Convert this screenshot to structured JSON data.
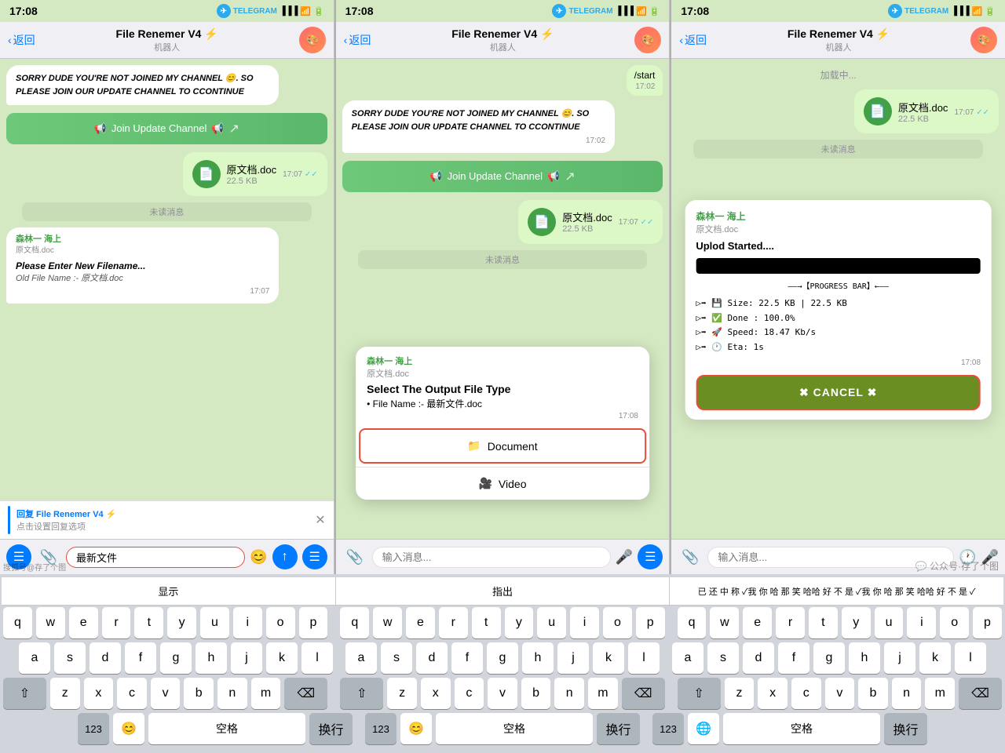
{
  "screens": [
    {
      "id": "screen1",
      "statusBar": {
        "time": "17:08",
        "telegramLabel": "TELEGRAM"
      },
      "navBar": {
        "backLabel": "返回",
        "titleMain": "File Renemer V4 ⚡",
        "titleSub": "机器人"
      },
      "messages": [
        {
          "type": "received",
          "text": "Sorry Dude You're Not Joined My Channel 😊. So Please Join Our Update Channel To Ccontinue",
          "time": ""
        },
        {
          "type": "join-button",
          "label": "📢 Join Update Channel 📢"
        },
        {
          "type": "sent-file",
          "name": "原文档.doc",
          "size": "22.5 KB",
          "time": "17:07"
        }
      ],
      "unreadDivider": "未读消息",
      "receivedMessages2": [
        {
          "type": "received-card",
          "sender": "森林一 海上",
          "filename": "原文档.doc",
          "text": "Please Enter New Filename...",
          "subtext": "Old File Name :- 原文档.doc",
          "time": "17:07"
        }
      ],
      "replyBar": {
        "botName": "回复 File Renemer V4 ⚡",
        "hint": "点击设置回复选项"
      },
      "inputBar": {
        "value": "最新文件",
        "placeholder": "输入消息..."
      }
    },
    {
      "id": "screen2",
      "statusBar": {
        "time": "17:08",
        "telegramLabel": "TELEGRAM"
      },
      "navBar": {
        "backLabel": "返回",
        "titleMain": "File Renemer V4 ⚡",
        "titleSub": "机器人"
      },
      "messages": [
        {
          "type": "sent-partial",
          "text": "/start",
          "time": "17:02"
        },
        {
          "type": "received",
          "text": "Sorry Dude You're Not Joined My Channel 😊. So Please Join Our Update Channel To Ccontinue",
          "time": "17:02"
        },
        {
          "type": "join-button",
          "label": "📢 Join Update Channel 📢"
        },
        {
          "type": "sent-file",
          "name": "原文档.doc",
          "size": "22.5 KB",
          "time": "17:07"
        }
      ],
      "unreadDivider": "未读消息",
      "popup": {
        "sender": "森林一 海上",
        "filename": "原文档.doc",
        "title": "Select The Output File Type",
        "subtitle": "• File Name :- 最新文件.doc",
        "time": "17:08",
        "btnDoc": "📁 Document",
        "btnVideo": "🎥 Video"
      },
      "inputBar": {
        "value": "",
        "placeholder": "输入消息..."
      }
    },
    {
      "id": "screen3",
      "statusBar": {
        "time": "17:08",
        "telegramLabel": "TELEGRAM"
      },
      "navBar": {
        "backLabel": "返回",
        "titleMain": "File Renemer V4 ⚡",
        "titleSub": "机器人"
      },
      "messages": [
        {
          "type": "loading",
          "text": "加载中..."
        },
        {
          "type": "sent-file",
          "name": "原文档.doc",
          "size": "22.5 KB",
          "time": "17:07"
        }
      ],
      "unreadDivider": "未读消息",
      "uploadPopup": {
        "sender": "森林一 海上",
        "filename": "原文档.doc",
        "title": "Uplod Started....",
        "progressLabel": "【PROGRESS BAR】",
        "stats": [
          "▷➡ 💾 Size: 22.5 KB | 22.5 KB",
          "▷➡ ✅ Done : 100.0%",
          "▷➡ 🚀 Speed: 18.47 Kb/s",
          "▷➡ 🕐 Eta: 1s"
        ],
        "time": "17:08",
        "cancelBtn": "✖ CANCEL ✖"
      },
      "inputBar": {
        "value": "",
        "placeholder": "输入消息..."
      }
    }
  ],
  "keyboard": {
    "predictive": [
      "显示",
      "指出",
      "已   还   中   称  ✓我   你   哈   那   笑   哈   哈   好   不   是  ✓我   你   哈   那   笑   哈   哈   好   不   是  ✓"
    ],
    "predictiveItems": [
      "显示",
      "指出",
      "已   还   中   称"
    ],
    "rows": [
      [
        "q",
        "w",
        "e",
        "r",
        "t",
        "y",
        "u",
        "i",
        "o",
        "p"
      ],
      [
        "a",
        "s",
        "d",
        "f",
        "g",
        "h",
        "j",
        "k",
        "l"
      ],
      [
        "⇧",
        "z",
        "x",
        "c",
        "v",
        "b",
        "n",
        "m",
        "⌫"
      ],
      [
        "123",
        "🌐",
        "空格",
        "换行"
      ]
    ]
  },
  "watermarkLeft": "搜狐号@存了个图",
  "watermarkRight": "公众号·存了个图"
}
